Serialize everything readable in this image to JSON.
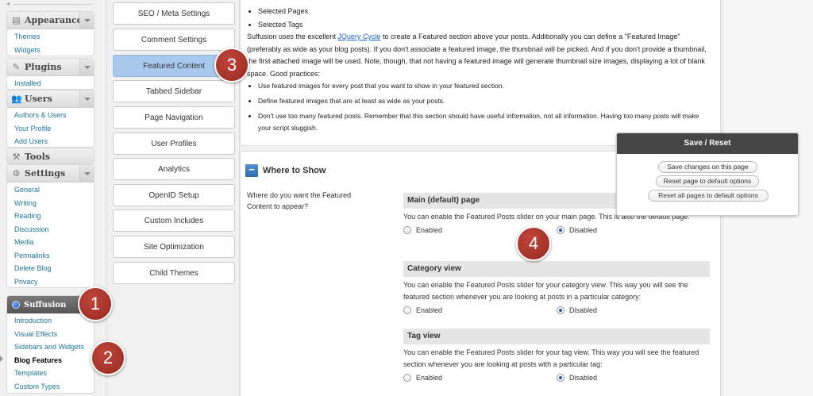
{
  "sidebar": {
    "appearance": {
      "label": "Appearance",
      "items": [
        "Themes",
        "Widgets"
      ]
    },
    "plugins": {
      "label": "Plugins",
      "items": [
        "Installed"
      ]
    },
    "users": {
      "label": "Users",
      "items": [
        "Authors & Users",
        "Your Profile",
        "Add Users"
      ]
    },
    "tools": {
      "label": "Tools"
    },
    "settings": {
      "label": "Settings",
      "items": [
        "General",
        "Writing",
        "Reading",
        "Discussion",
        "Media",
        "Permalinks",
        "Delete Blog",
        "Privacy"
      ]
    },
    "suffusion": {
      "label": "Suffusion",
      "items": [
        "Introduction",
        "Visual Effects",
        "Sidebars and Widgets",
        "Blog Features",
        "Templates",
        "Custom Types"
      ],
      "current": "Blog Features"
    }
  },
  "tabs": [
    "SEO / Meta Settings",
    "Comment Settings",
    "Featured Content",
    "Tabbed Sidebar",
    "Page Navigation",
    "User Profiles",
    "Analytics",
    "OpenID Setup",
    "Custom Includes",
    "Site Optimization",
    "Child Themes"
  ],
  "active_tab": "Featured Content",
  "description": {
    "bullets_top": [
      "Selected Pages",
      "Selected Tags"
    ],
    "para_pre": "Suffusion uses the excellent ",
    "para_link": "JQuery Cycle",
    "para_post": " to create a Featured section above your posts. Additionally you can define a \"Featured Image\" (preferably as wide as your blog posts). If you don't associate a featured image, the thumbnail will be picked. And if you don't provide a thumbnail, the first attached image will be used. Note, though, that not having a featured image will generate thumbnail size images, displaying a lot of blank space. Good practices:",
    "practices": [
      "Use featured images for every post that you want to show in your featured section.",
      "Define featured images that are at least as wide as your posts.",
      "Don't use too many featured posts. Remember that this section should have useful information, not all information. Having too many posts will make your script sluggish."
    ]
  },
  "where": {
    "title": "Where to Show",
    "minus": "−",
    "question": "Where do you want the Featured Content to appear?",
    "sections": [
      {
        "title": "Main (default) page",
        "desc": "You can enable the Featured Posts slider on your main page. This is also the default page:",
        "enabled_label": "Enabled",
        "disabled_label": "Disabled",
        "selected": "Disabled"
      },
      {
        "title": "Category view",
        "desc": "You can enable the Featured Posts slider for your category view. This way you will see the featured section whenever you are looking at posts in a particular category:",
        "enabled_label": "Enabled",
        "disabled_label": "Disabled",
        "selected": "Disabled"
      },
      {
        "title": "Tag view",
        "desc": "You can enable the Featured Posts slider for your tag view. This way you will see the featured section whenever you are looking at posts with a particular tag:",
        "enabled_label": "Enabled",
        "disabled_label": "Disabled",
        "selected": "Disabled"
      }
    ]
  },
  "save_box": {
    "title": "Save / Reset",
    "buttons": [
      "Save changes on this page",
      "Reset page to default options",
      "Reset all pages to default options"
    ]
  },
  "callouts": [
    "1",
    "2",
    "3",
    "4"
  ]
}
